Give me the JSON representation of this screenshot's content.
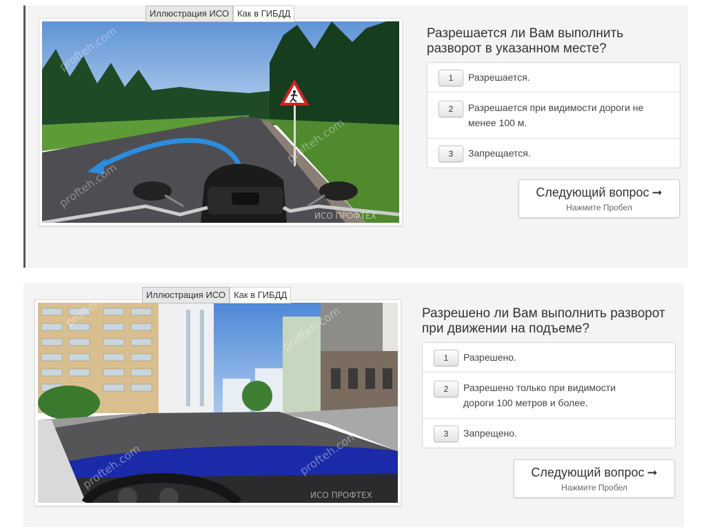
{
  "tabs": {
    "iso": "Иллюстрация ИСО",
    "gibdd": "Как в ГИБДД"
  },
  "watermarks": {
    "site": "profteh.com",
    "brand": "ИСО ПРОФТЕХ"
  },
  "questions": [
    {
      "text_line1": "Разрешается ли Вам выполнить",
      "text_line2": "разворот в указанном месте?",
      "answers": [
        {
          "num": "1",
          "line1": "Разрешается.",
          "line2": ""
        },
        {
          "num": "2",
          "line1": "Разрешается при видимости дороги не",
          "line2": "менее 100 м."
        },
        {
          "num": "3",
          "line1": "Запрещается.",
          "line2": ""
        }
      ],
      "next": {
        "label": "Следующий вопрос",
        "arrow": "➞",
        "hint": "Нажмите Пробел"
      }
    },
    {
      "text_line1": "Разрешено ли Вам выполнить разворот",
      "text_line2": "при движении на подъеме?",
      "answers": [
        {
          "num": "1",
          "line1": "Разрешено.",
          "line2": ""
        },
        {
          "num": "2",
          "line1": "Разрешено только при видимости",
          "line2": "дороги 100 метров и более."
        },
        {
          "num": "3",
          "line1": "Запрещено.",
          "line2": ""
        }
      ],
      "next": {
        "label": "Следующий вопрос",
        "arrow": "➞",
        "hint": "Нажмите Пробел"
      }
    }
  ],
  "colors": {
    "turn_arrow": "#2b8de0",
    "sign_border": "#d42020",
    "hood_blue": "#1a2aa8"
  }
}
